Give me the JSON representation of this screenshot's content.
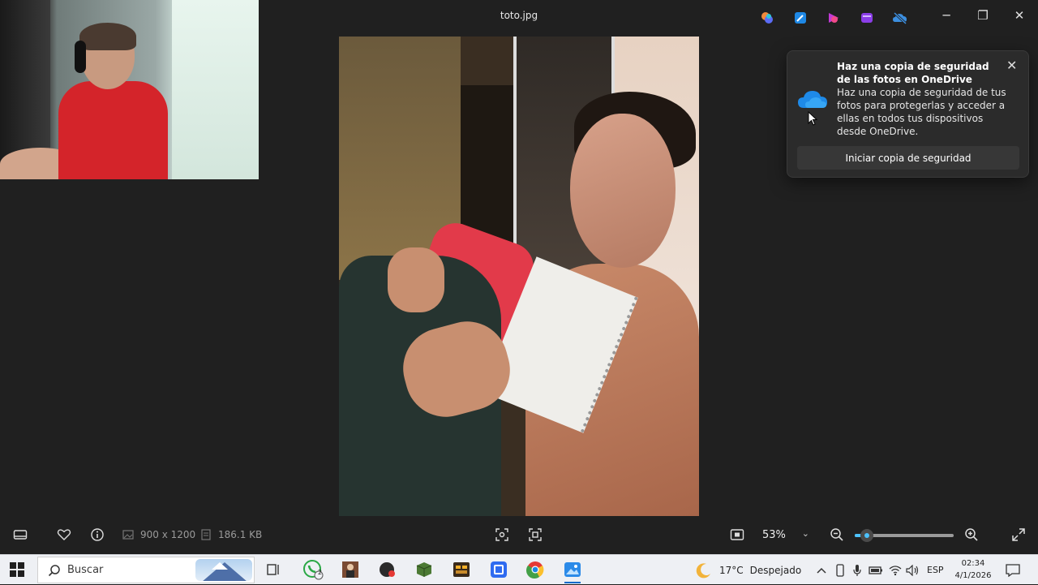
{
  "window": {
    "title": "toto.jpg",
    "controls": {
      "minimize": "─",
      "maximize": "❐",
      "close": "✕"
    }
  },
  "toast": {
    "title": "Haz una copia de seguridad de las fotos en OneDrive",
    "body": "Haz una copia de seguridad de tus fotos para protegerlas y acceder a ellas en todos tus dispositivos desde OneDrive.",
    "button": "Iniciar copia de seguridad",
    "close": "✕",
    "icon": "onedrive-cloud-icon"
  },
  "bottombar": {
    "dimensions": "900 x 1200",
    "filesize": "186.1 KB",
    "zoom": "53%",
    "zoom_chevron": "⌄",
    "zoom_percent": 53,
    "slider_fraction": 0.12
  },
  "taskbar": {
    "search_placeholder": "Buscar",
    "weather_temp": "17°C",
    "weather_text": "Despejado",
    "language": "ESP",
    "time": "02:34",
    "date": "4/1/2026",
    "whatsapp_badge": "2"
  },
  "colors": {
    "accent": "#4cc2ff",
    "app_bg": "#202020",
    "taskbar_bg": "#eef0f4"
  }
}
